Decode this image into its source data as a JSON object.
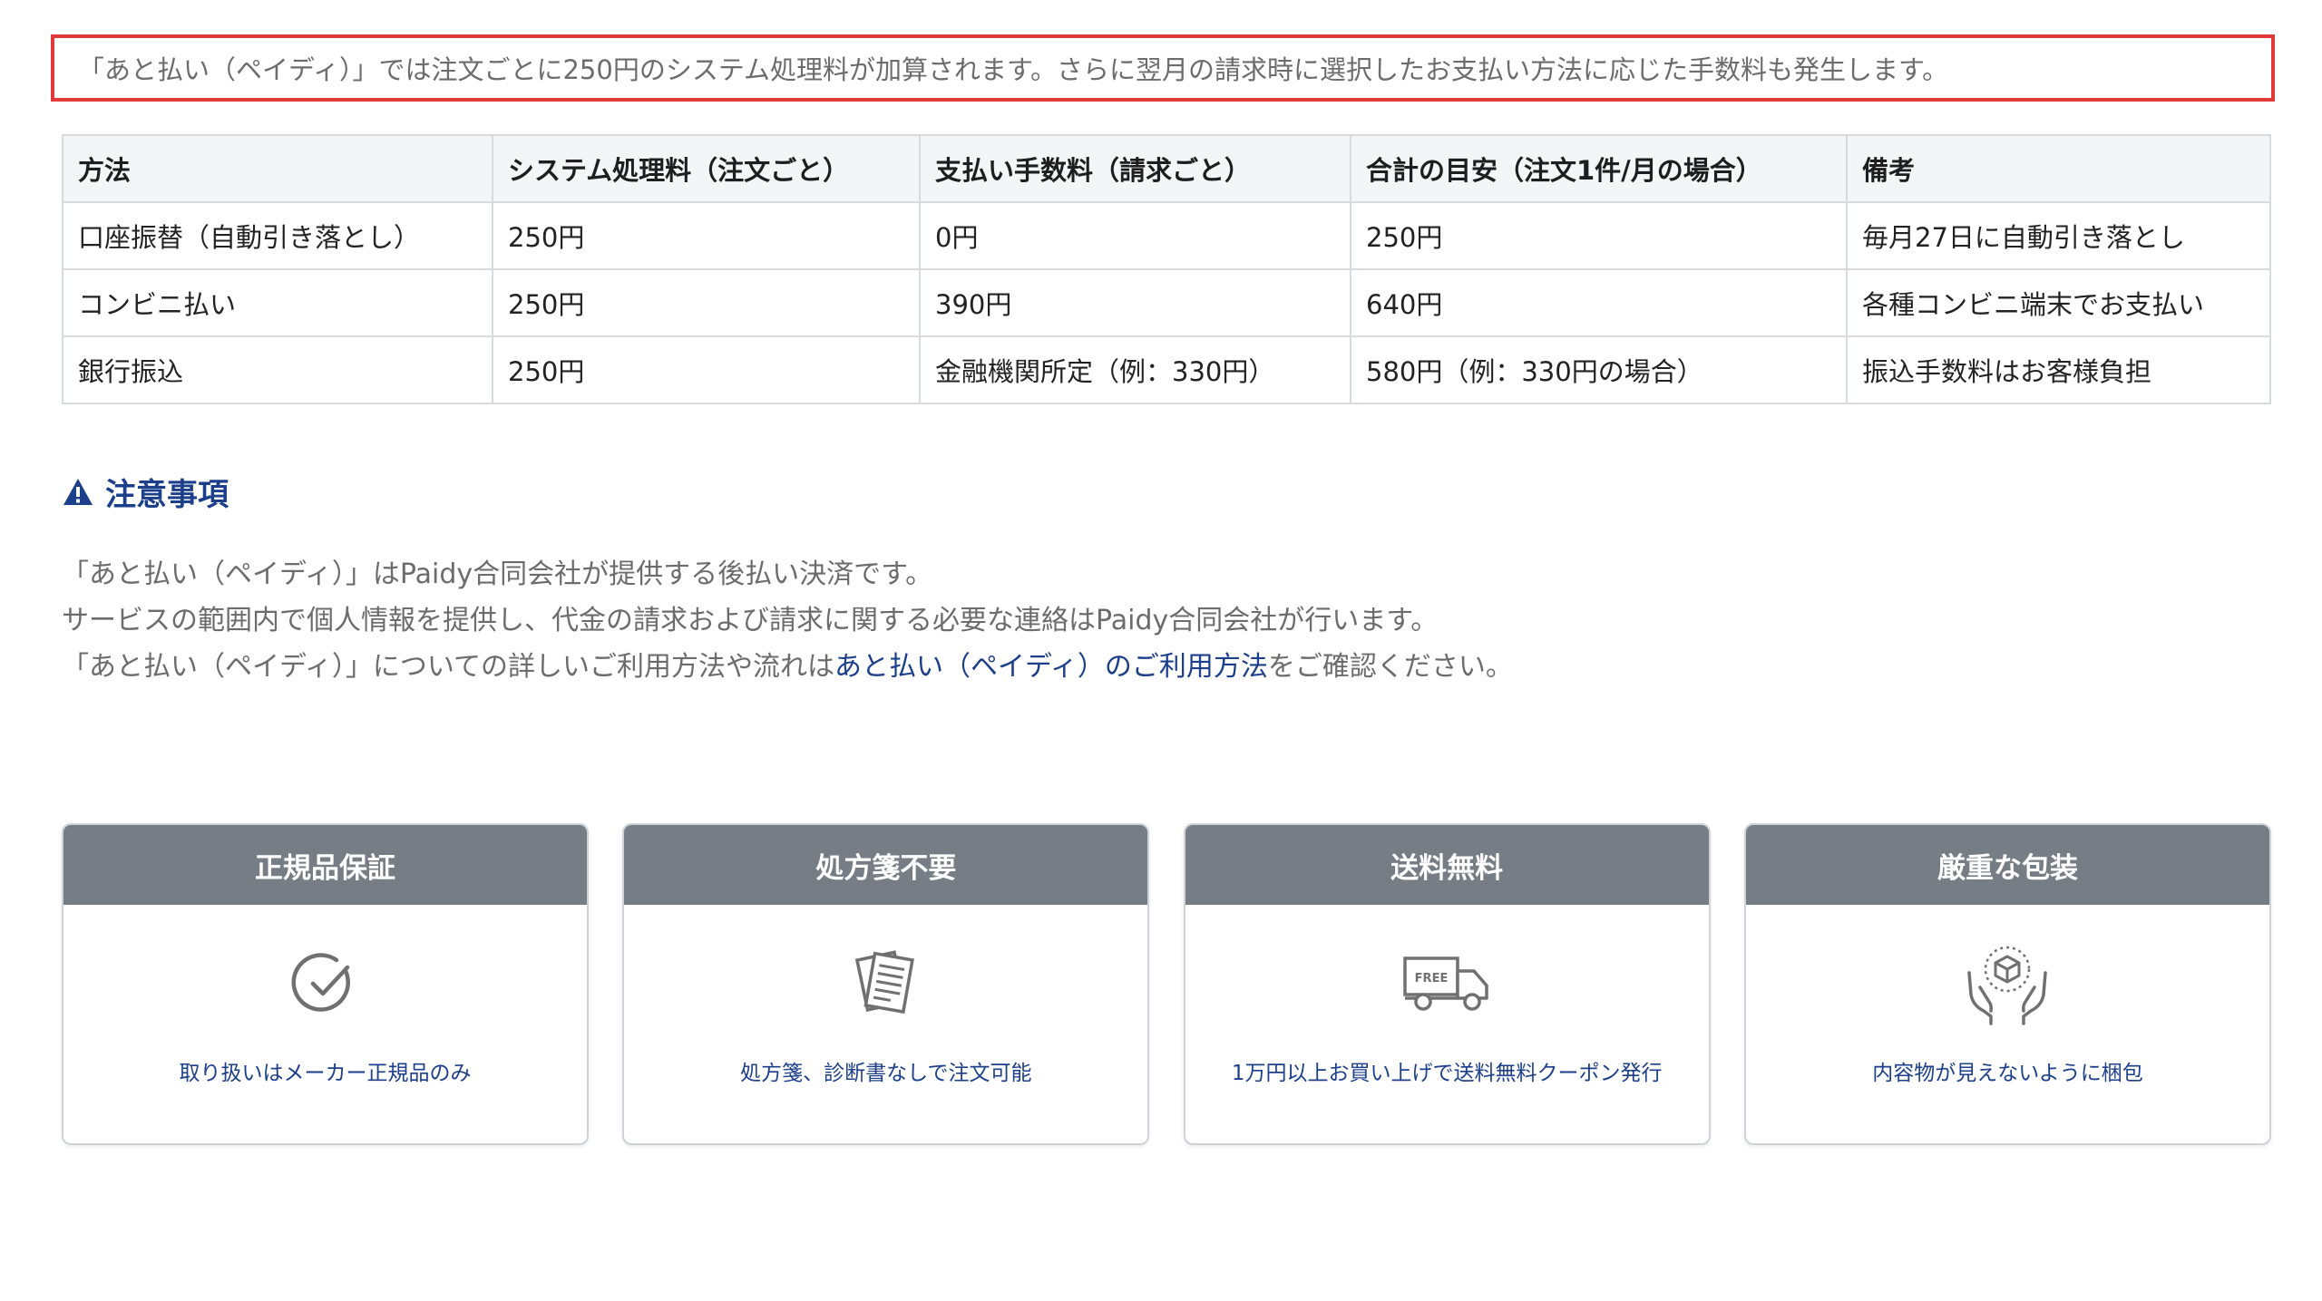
{
  "notice": {
    "text": "「あと払い（ペイディ）」では注文ごとに250円のシステム処理料が加算されます。さらに翌月の請求時に選択したお支払い方法に応じた手数料も発生します。"
  },
  "fee_table": {
    "headers": [
      "方法",
      "システム処理料（注文ごと）",
      "支払い手数料（請求ごと）",
      "合計の目安（注文1件/月の場合）",
      "備考"
    ],
    "rows": [
      [
        "口座振替（自動引き落とし）",
        "250円",
        "0円",
        "250円",
        "毎月27日に自動引き落とし"
      ],
      [
        "コンビニ払い",
        "250円",
        "390円",
        "640円",
        "各種コンビニ端末でお支払い"
      ],
      [
        "銀行振込",
        "250円",
        "金融機関所定（例：330円）",
        "580円（例：330円の場合）",
        "振込手数料はお客様負担"
      ]
    ]
  },
  "caution": {
    "icon": "warning-icon",
    "title": "注意事項",
    "line1": "「あと払い（ペイディ）」はPaidy合同会社が提供する後払い決済です。",
    "line2": "サービスの範囲内で個人情報を提供し、代金の請求および請求に関する必要な連絡はPaidy合同会社が行います。",
    "line3_prefix": "「あと払い（ペイディ）」についての詳しいご利用方法や流れは",
    "line3_link": "あと払い（ペイディ）のご利用方法",
    "line3_suffix": "をご確認ください。"
  },
  "features": [
    {
      "title": "正規品保証",
      "icon": "check-circle-icon",
      "text": "取り扱いはメーカー正規品のみ"
    },
    {
      "title": "処方箋不要",
      "icon": "documents-icon",
      "text": "処方箋、診断書なしで注文可能"
    },
    {
      "title": "送料無料",
      "icon": "free-truck-icon",
      "icon_label": "FREE",
      "text": "1万円以上お買い上げで送料無料クーポン発行"
    },
    {
      "title": "厳重な包装",
      "icon": "hands-package-icon",
      "text": "内容物が見えないように梱包"
    }
  ],
  "colors": {
    "notice_border": "#e03a3a",
    "accent_blue": "#1c3f8c",
    "card_header": "#767d85",
    "muted_text": "#6c6c6c"
  }
}
